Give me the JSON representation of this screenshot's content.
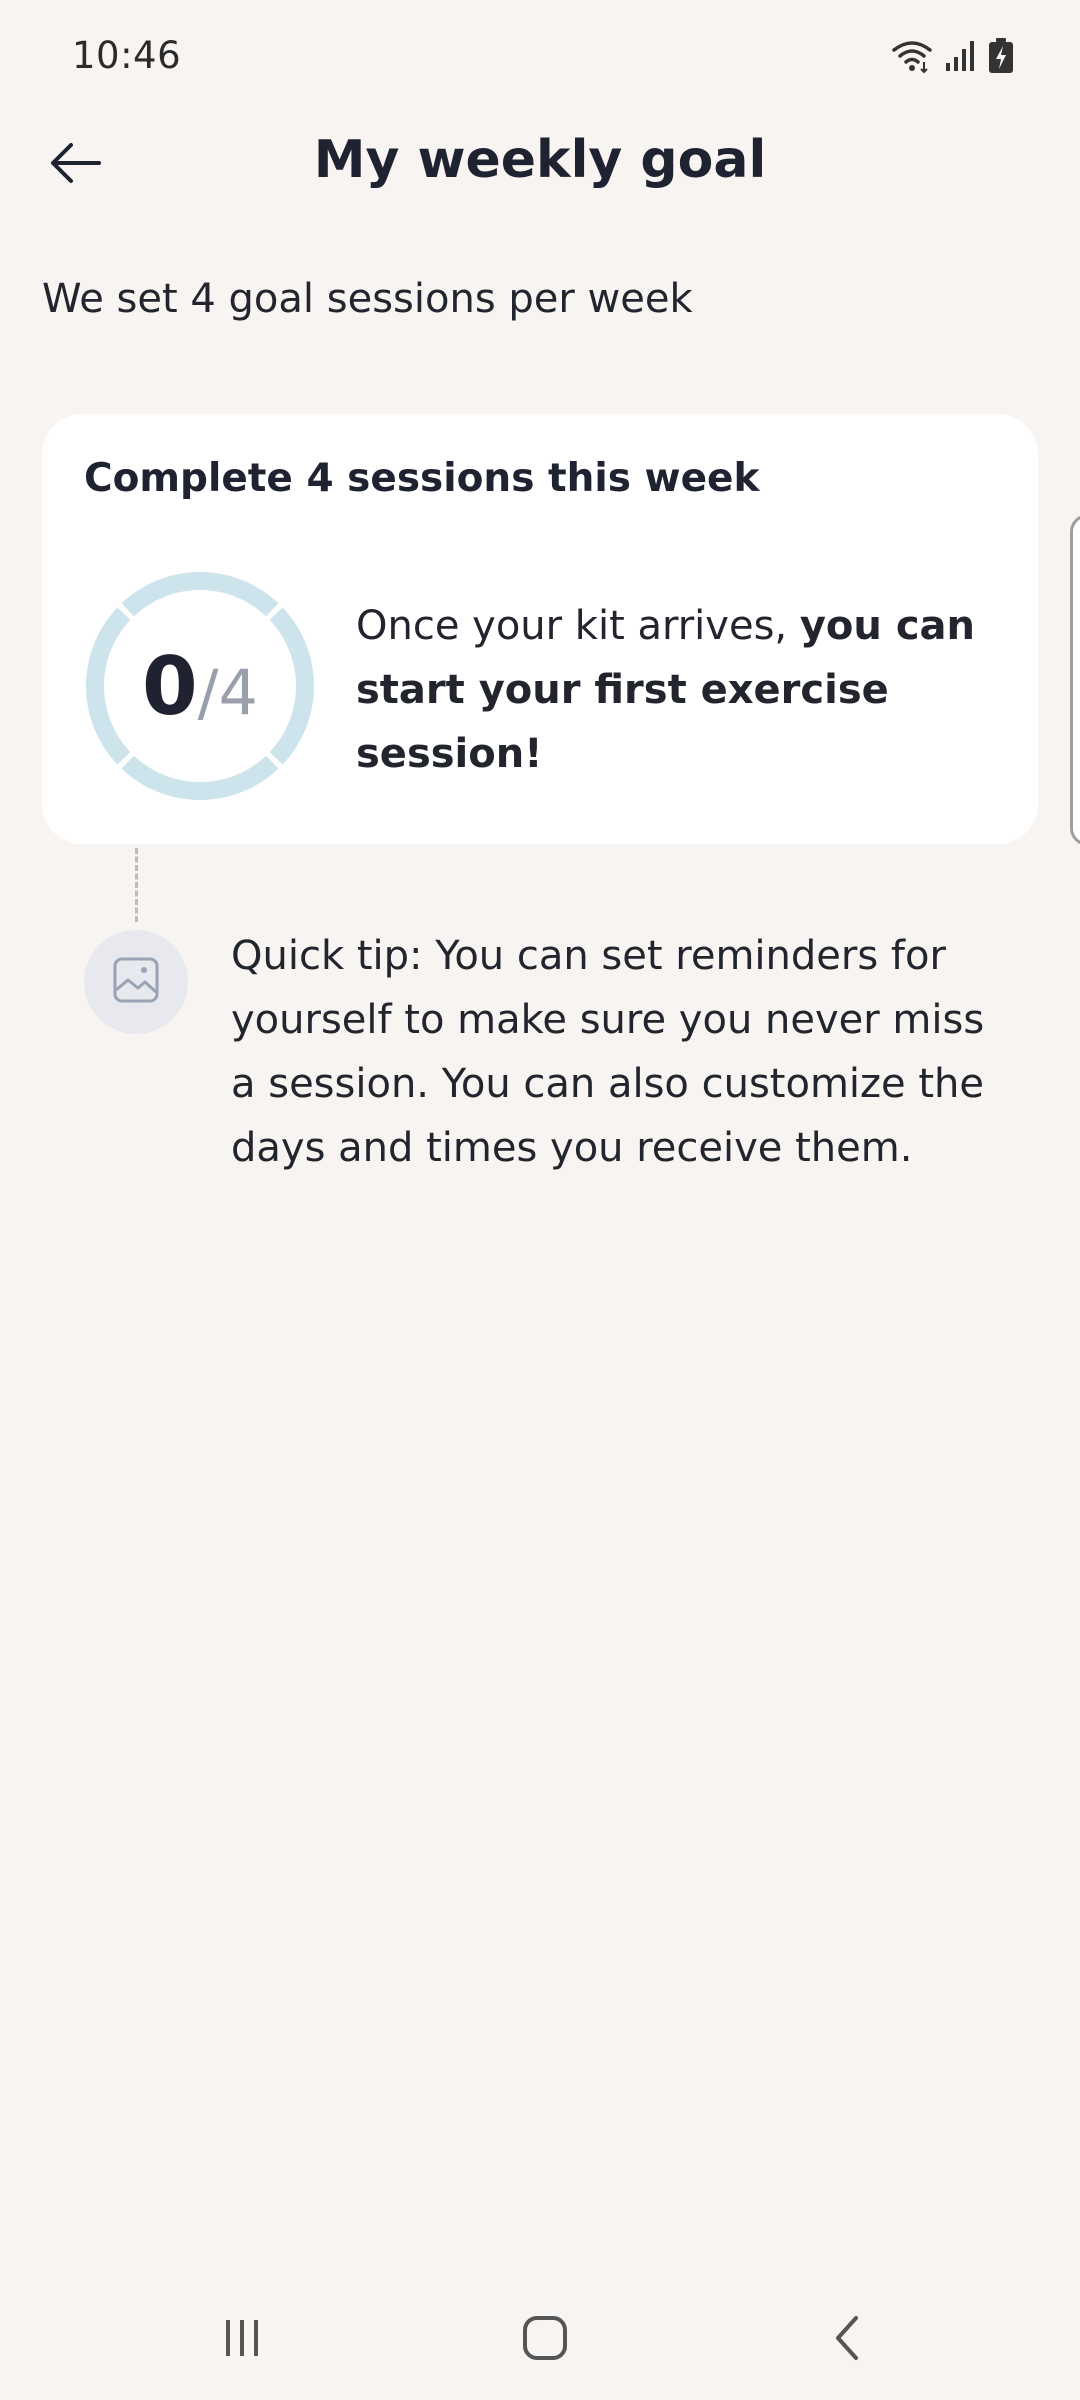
{
  "status_bar": {
    "time": "10:46",
    "icons": [
      "wifi-icon",
      "signal-icon",
      "battery-charging-icon"
    ]
  },
  "header": {
    "title": "My weekly goal",
    "back_icon": "arrow-left-icon"
  },
  "subtitle": "We set 4 goal sessions per week",
  "goal_card": {
    "title": "Complete 4 sessions this week",
    "progress": {
      "completed": "0",
      "separator": "/",
      "total": "4",
      "completed_value": 0,
      "total_value": 4,
      "segments": 4,
      "ring_color": "#cde4ec"
    },
    "message_plain": "Once your kit arrives, ",
    "message_bold": "you can start your first exercise session!"
  },
  "tip": {
    "icon": "image-placeholder-icon",
    "text": "Quick tip: You can set reminders for yourself to make sure you never miss a session. You can also customize the days and times you receive them."
  },
  "nav_bar": {
    "icons": [
      "recent-apps-icon",
      "home-icon",
      "back-icon"
    ]
  },
  "colors": {
    "background": "#f7f4f1",
    "card": "#ffffff",
    "text": "#1f2230",
    "muted": "#9aa0ab"
  }
}
